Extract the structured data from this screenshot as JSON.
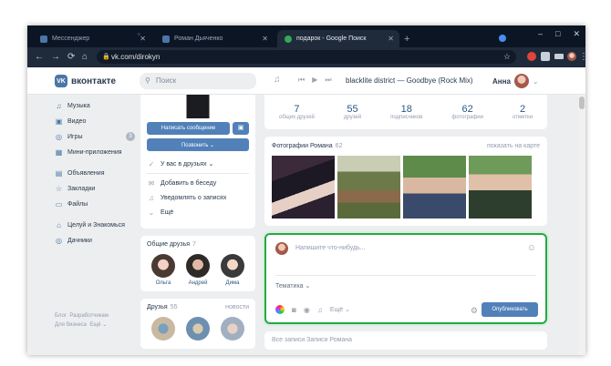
{
  "browser": {
    "tabs": [
      {
        "label": "Мессенджер",
        "color": "#4a76a8"
      },
      {
        "label": "Роман Дьяченко",
        "color": "#4a76a8"
      },
      {
        "label": "подарок - Google Поиск",
        "color": "#34a853"
      }
    ],
    "url": "vk.com/dirokyn"
  },
  "header": {
    "logo_text": "вконтакте",
    "logo_mark": "VK",
    "search_placeholder": "Поиск",
    "track": "blacklite district — Goodbye (Rock Mix)",
    "user_name": "Анна"
  },
  "sidebar": {
    "items": [
      {
        "label": "Музыка",
        "icon": "music-icon",
        "glyph": "♫"
      },
      {
        "label": "Видео",
        "icon": "video-icon",
        "glyph": "▣"
      },
      {
        "label": "Игры",
        "icon": "gamepad-icon",
        "glyph": "◎",
        "badge": "3"
      },
      {
        "label": "Мини-приложения",
        "icon": "apps-icon",
        "glyph": "▦"
      },
      {
        "label": "Объявления",
        "icon": "ads-icon",
        "glyph": "▤"
      },
      {
        "label": "Закладки",
        "icon": "bookmark-icon",
        "glyph": "☆"
      },
      {
        "label": "Файлы",
        "icon": "file-icon",
        "glyph": "▭"
      },
      {
        "label": "Целуй и Знакомься",
        "icon": "app-icon",
        "glyph": "⌂"
      },
      {
        "label": "Дачники",
        "icon": "gamepad-icon",
        "glyph": "◎"
      }
    ],
    "footer": [
      "Блог",
      "Разработчикам",
      "Для бизнеса",
      "Ещё ⌄"
    ]
  },
  "profile": {
    "message_button": "Написать сообщение",
    "call_button": "Позвонить ⌄",
    "actions": [
      {
        "label": "У вас в друзьях ⌄",
        "icon": "friend-check-icon",
        "glyph": "✓"
      },
      {
        "label": "Добавить в беседу",
        "icon": "chat-add-icon",
        "glyph": "✉"
      },
      {
        "label": "Уведомлять о записях",
        "icon": "bell-icon",
        "glyph": "♫"
      },
      {
        "label": "Ещё",
        "icon": "chevron-down-icon",
        "glyph": "⌄"
      }
    ]
  },
  "mutual_friends": {
    "title": "Общие друзья",
    "count": "7",
    "people": [
      "Ольга",
      "Андрей",
      "Дима"
    ]
  },
  "friends": {
    "title": "Друзья",
    "count": "55",
    "link": "новости"
  },
  "stats": [
    {
      "n": "7",
      "l": "общих друзей"
    },
    {
      "n": "55",
      "l": "друзей"
    },
    {
      "n": "18",
      "l": "подписчиков"
    },
    {
      "n": "62",
      "l": "фотографии"
    },
    {
      "n": "2",
      "l": "отметки"
    }
  ],
  "photos": {
    "title": "Фотографии Романа",
    "count": "62",
    "map_link": "показать на карте"
  },
  "composer": {
    "placeholder": "Напишите что-нибудь...",
    "topic": "Тематика ⌄",
    "more": "Ещё ⌄",
    "publish": "Опубликовать"
  },
  "next_card": "Все записи      Записи Романа"
}
